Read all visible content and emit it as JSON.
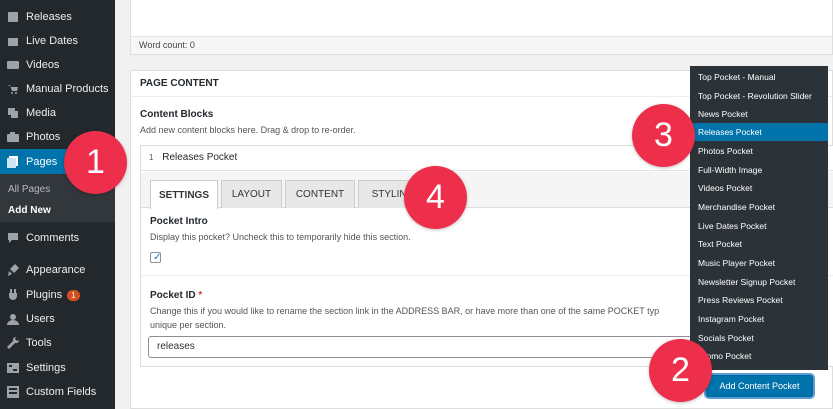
{
  "sidebar": {
    "items": [
      {
        "label": "Releases",
        "icon": "releases-icon"
      },
      {
        "label": "Live Dates",
        "icon": "calendar-icon"
      },
      {
        "label": "Videos",
        "icon": "video-icon"
      },
      {
        "label": "Manual Products",
        "icon": "cart-icon"
      },
      {
        "label": "Media",
        "icon": "media-icon"
      },
      {
        "label": "Photos",
        "icon": "camera-icon"
      },
      {
        "label": "Pages",
        "icon": "pages-icon"
      },
      {
        "label": "Comments",
        "icon": "comment-icon"
      },
      {
        "label": "Appearance",
        "icon": "brush-icon"
      },
      {
        "label": "Plugins",
        "icon": "plug-icon",
        "badge": "1"
      },
      {
        "label": "Users",
        "icon": "user-icon"
      },
      {
        "label": "Tools",
        "icon": "wrench-icon"
      },
      {
        "label": "Settings",
        "icon": "settings-icon"
      },
      {
        "label": "Custom Fields",
        "icon": "grid-icon"
      }
    ],
    "submenu": {
      "all_pages": "All Pages",
      "add_new": "Add New"
    },
    "active_color": "#0073aa"
  },
  "editor": {
    "word_count": "Word count: 0"
  },
  "panel": {
    "title": "PAGE CONTENT",
    "content_blocks_label": "Content Blocks",
    "content_blocks_desc": "Add new content blocks here. Drag & drop to re-order.",
    "block": {
      "number": "1",
      "name": "Releases Pocket",
      "tabs": [
        "SETTINGS",
        "LAYOUT",
        "CONTENT",
        "STYLING"
      ],
      "pocket_intro_label": "Pocket Intro",
      "pocket_intro_desc": "Display this pocket? Uncheck this to temporarily hide this section.",
      "pocket_intro_checked": true,
      "pocket_id_label": "Pocket ID",
      "required_mark": "*",
      "pocket_id_desc_line1": "Change this if you would like to rename the section link in the ADDRESS BAR, or have more than one of the same POCKET typ",
      "pocket_id_desc_line2": "unique per section.",
      "pocket_id_value": "releases"
    }
  },
  "dropdown": {
    "items": [
      "Top Pocket - Manual",
      "Top Pocket - Revolution Slider",
      "News Pocket",
      "Releases Pocket",
      "Photos Pocket",
      "Full-Width Image",
      "Videos Pocket",
      "Merchandise Pocket",
      "Live Dates Pocket",
      "Text Pocket",
      "Music Player Pocket",
      "Newsletter Signup Pocket",
      "Press Reviews Pocket",
      "Instagram Pocket",
      "Socials Pocket",
      "Promo Pocket"
    ],
    "highlighted": "Releases Pocket"
  },
  "add_button": "Add Content Pocket",
  "callouts": [
    "1",
    "2",
    "3",
    "4"
  ],
  "colors": {
    "callout": "#ee2f4b",
    "accent": "#0073aa",
    "sidebar_bg": "#23282d"
  }
}
